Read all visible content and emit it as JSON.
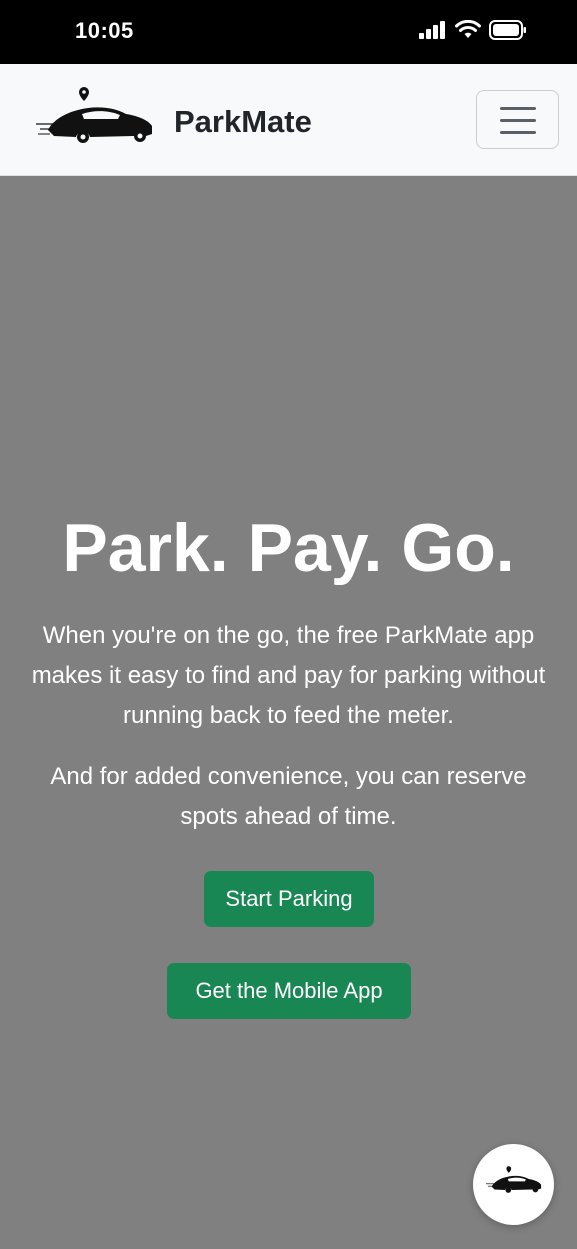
{
  "status_bar": {
    "time": "10:05",
    "icons": [
      "signal-icon",
      "wifi-icon",
      "battery-icon"
    ]
  },
  "navbar": {
    "brand": "ParkMate",
    "logo_icon": "car-with-location-pin-logo",
    "menu_icon": "hamburger-menu-icon"
  },
  "hero": {
    "title": "Park. Pay. Go.",
    "lead_line1": "When you're on the go, the free ParkMate app",
    "lead_line2": "makes it easy to find and pay for parking without",
    "lead_line3": "running back to feed the meter.",
    "sub_line1": "And for added convenience, you can reserve",
    "sub_line2": "spots ahead of time.",
    "start_button": "Start Parking",
    "app_button": "Get the Mobile App"
  },
  "fab": {
    "icon": "car-logo-icon"
  },
  "colors": {
    "hero_background": "#808080",
    "button_green": "#198754",
    "navbar_background": "#f8f9fa",
    "status_bar_background": "#000000"
  }
}
